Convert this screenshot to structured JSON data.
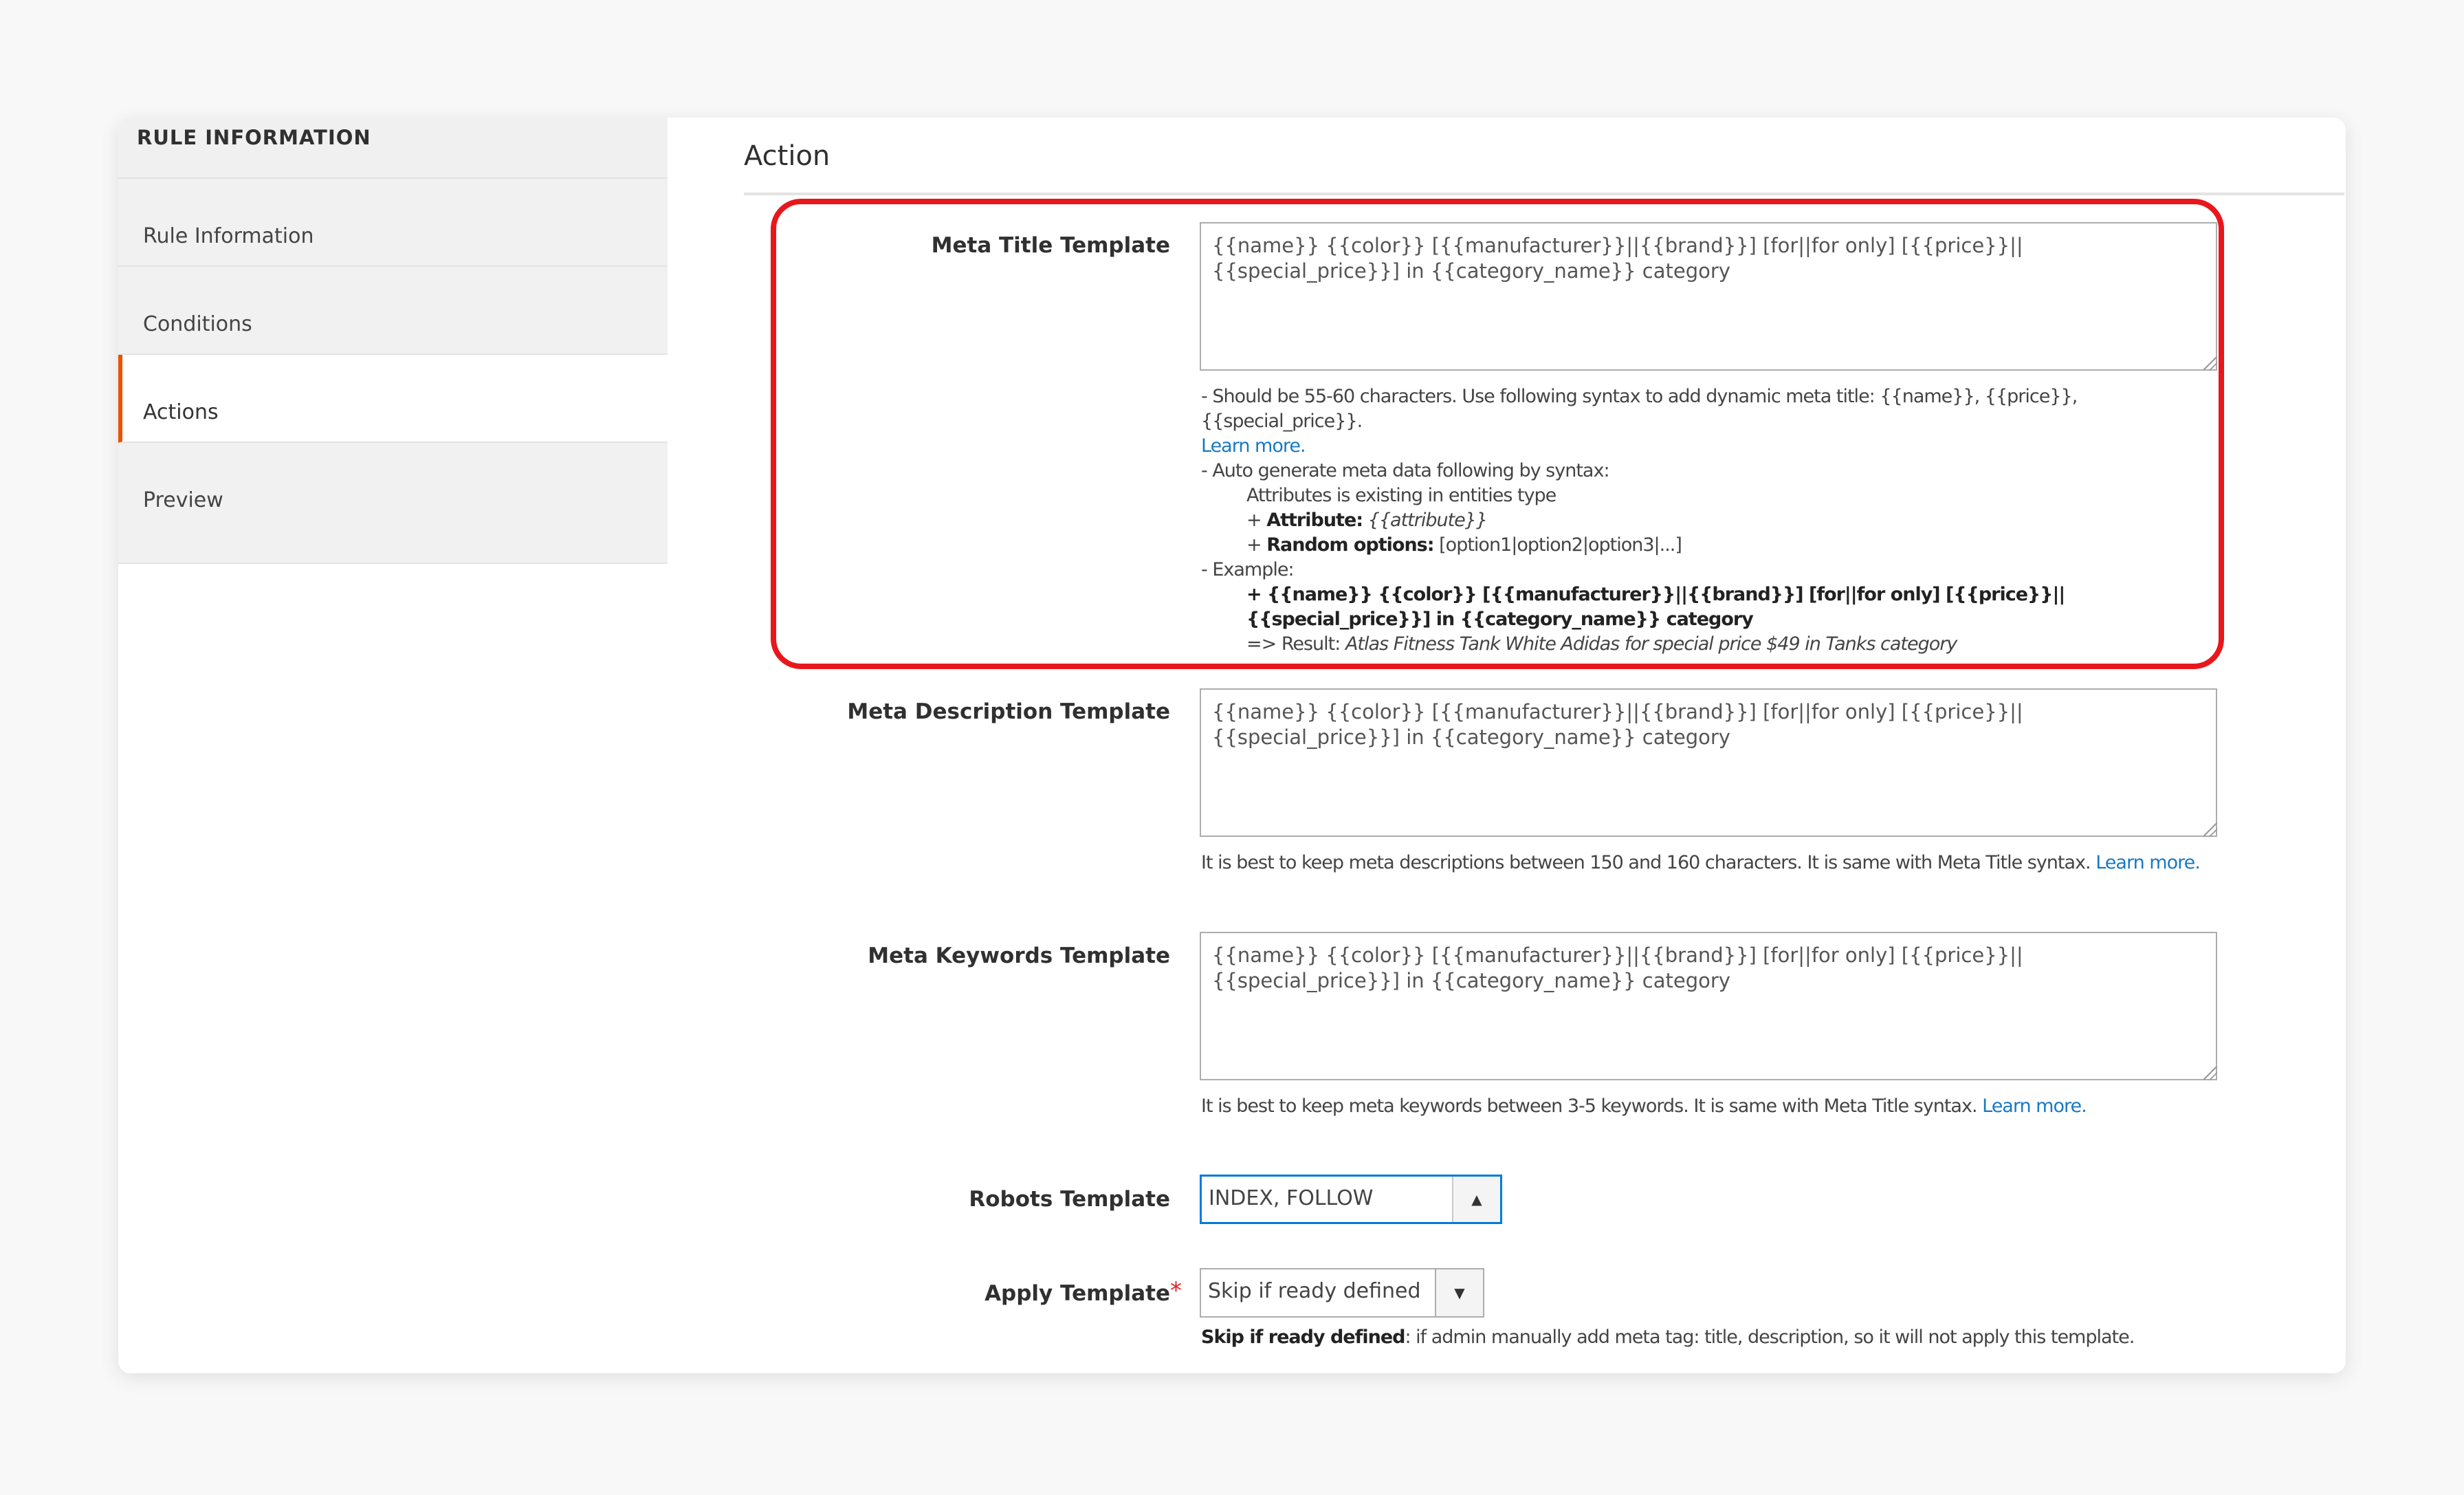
{
  "sidebar": {
    "title": "RULE INFORMATION",
    "items": [
      {
        "label": "Rule Information",
        "active": false
      },
      {
        "label": "Conditions",
        "active": false
      },
      {
        "label": "Actions",
        "active": true
      },
      {
        "label": "Preview",
        "active": false
      }
    ]
  },
  "main": {
    "section_title": "Action",
    "meta_title": {
      "label": "Meta Title Template",
      "value": "{{name}} {{color}} [{{manufacturer}}||{{brand}}] [for||for only] [{{price}}||{{special_price}}] in {{category_name}} category",
      "notes": {
        "line1": "- Should be 55-60 characters. Use following syntax to add dynamic meta title: {{name}}, {{price}}, {{special_price}}.",
        "learn_more": "Learn more.",
        "line2": "- Auto generate meta data following by syntax:",
        "line3": "Attributes is existing in entities type",
        "attr_prefix": "+ ",
        "attr_label": "Attribute:",
        "attr_value": "{{attribute}}",
        "rand_label": "Random options:",
        "rand_value": "[option1|option2|option3|...]",
        "line4": "- Example:",
        "example": "+ {{name}} {{color}} [{{manufacturer}}||{{brand}}] [for||for only] [{{price}}||{{special_price}}] in {{category_name}} category",
        "result_prefix": "=> Result:",
        "result_value": "Atlas Fitness Tank White Adidas for special price $49 in Tanks category"
      }
    },
    "meta_description": {
      "label": "Meta Description Template",
      "value": "{{name}} {{color}} [{{manufacturer}}||{{brand}}] [for||for only] [{{price}}||{{special_price}}] in {{category_name}} category",
      "note": "It is best to keep meta descriptions between 150 and 160 characters. It is same with Meta Title syntax.",
      "learn_more": "Learn more."
    },
    "meta_keywords": {
      "label": "Meta Keywords Template",
      "value": "{{name}} {{color}} [{{manufacturer}}||{{brand}}] [for||for only] [{{price}}||{{special_price}}] in {{category_name}} category",
      "note": "It is best to keep meta keywords between 3-5 keywords. It is same with Meta Title syntax.",
      "learn_more": "Learn more."
    },
    "robots": {
      "label": "Robots Template",
      "value": "INDEX, FOLLOW",
      "arrow": "▲"
    },
    "apply": {
      "label": "Apply Template",
      "required": "*",
      "value": "Skip if ready defined",
      "arrow": "▼",
      "note_bold": "Skip if ready defined",
      "note": ": if admin manually add meta tag: title, description, so it will not apply this template."
    }
  },
  "colors": {
    "active_accent": "#eb5202",
    "link": "#1979c3",
    "highlight": "#e8171c",
    "focus": "#007bdb"
  }
}
